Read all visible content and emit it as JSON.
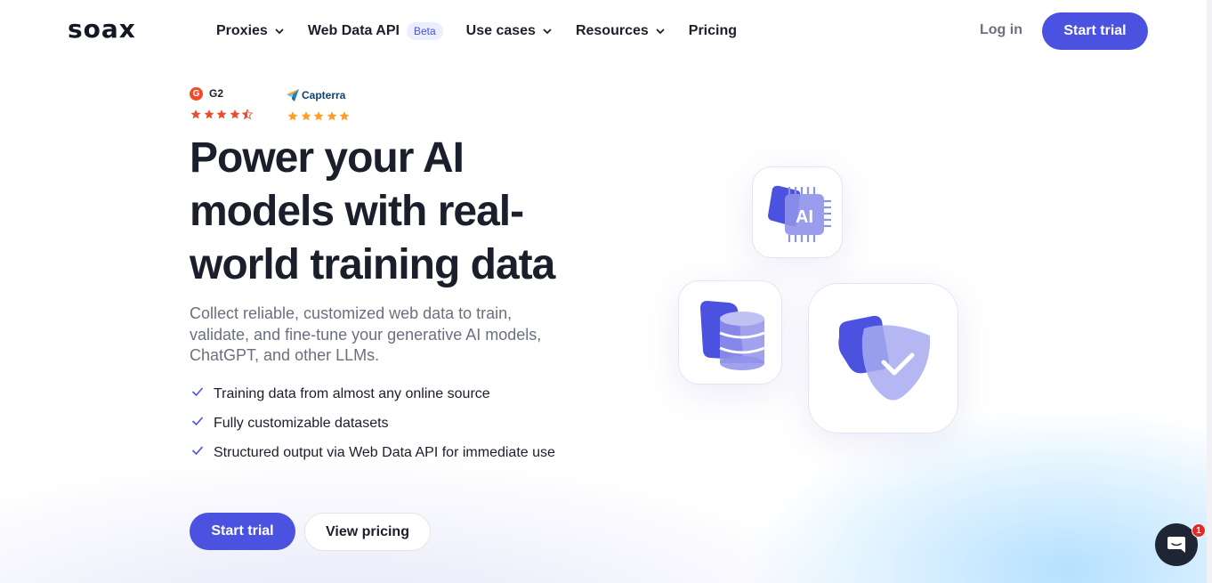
{
  "brand": {
    "logo_text": "soax",
    "accent_color": "#4b52e0"
  },
  "nav": {
    "items": [
      {
        "label": "Proxies",
        "dropdown": true
      },
      {
        "label": "Web Data API",
        "badge": "Beta",
        "dropdown": false
      },
      {
        "label": "Use cases",
        "dropdown": true
      },
      {
        "label": "Resources",
        "dropdown": true
      },
      {
        "label": "Pricing",
        "dropdown": false
      }
    ],
    "login_label": "Log in",
    "start_trial_label": "Start trial"
  },
  "ratings": {
    "g2": {
      "label": "G2",
      "stars": 4.5,
      "star_color": "#ef4a2a"
    },
    "capterra": {
      "label": "Capterra",
      "stars": 5,
      "star_color": "#ff9d28"
    }
  },
  "hero": {
    "title": "Power your AI models with real-world training data",
    "subtitle": "Collect reliable, customized web data to train, validate, and fine-tune your generative AI models, ChatGPT, and other LLMs.",
    "features": [
      "Training data from almost any online source",
      "Fully customizable datasets",
      "Structured output via Web Data API for immediate use"
    ],
    "primary_cta": "Start trial",
    "secondary_cta": "View pricing"
  },
  "illustrations": {
    "ai_chip": {
      "label": "AI",
      "icon": "ai-chip-icon"
    },
    "database": {
      "icon": "database-icon"
    },
    "shield": {
      "icon": "shield-check-icon"
    }
  },
  "chat_widget": {
    "icon": "chat-icon",
    "unread_count": "1"
  }
}
